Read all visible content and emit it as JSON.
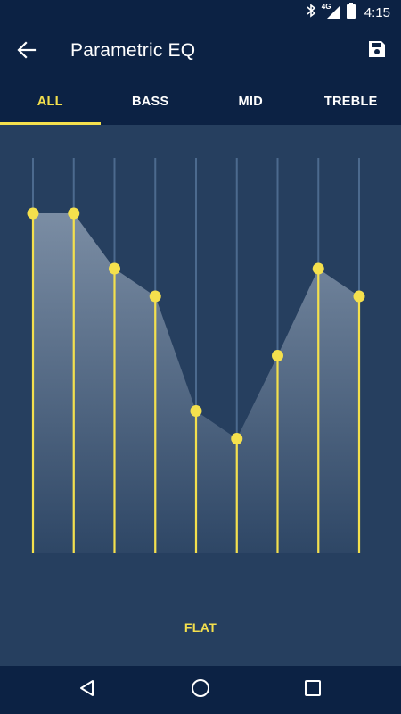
{
  "status_bar": {
    "time": "4:15",
    "network_label": "4G",
    "icons": [
      "bluetooth-icon",
      "signal-icon",
      "battery-icon"
    ]
  },
  "app_bar": {
    "title": "Parametric EQ",
    "back_icon": "arrow-left-icon",
    "save_icon": "save-icon"
  },
  "tabs": [
    {
      "label": "ALL",
      "active": true
    },
    {
      "label": "BASS",
      "active": false
    },
    {
      "label": "MID",
      "active": false
    },
    {
      "label": "TREBLE",
      "active": false
    }
  ],
  "equalizer": {
    "band_count": 9,
    "band_levels": [
      0.86,
      0.86,
      0.72,
      0.65,
      0.36,
      0.29,
      0.5,
      0.72,
      0.65
    ],
    "accent_color": "#f4e04d",
    "track_color": "#4c6a8e",
    "fill_color": "#8a9bb0"
  },
  "flat_button": {
    "label": "FLAT"
  },
  "nav_bar": {
    "icons": [
      "back-triangle-icon",
      "home-circle-icon",
      "recents-square-icon"
    ]
  },
  "colors": {
    "primary_dark": "#0c2244",
    "background": "#263f5f",
    "accent": "#f4e04d"
  }
}
